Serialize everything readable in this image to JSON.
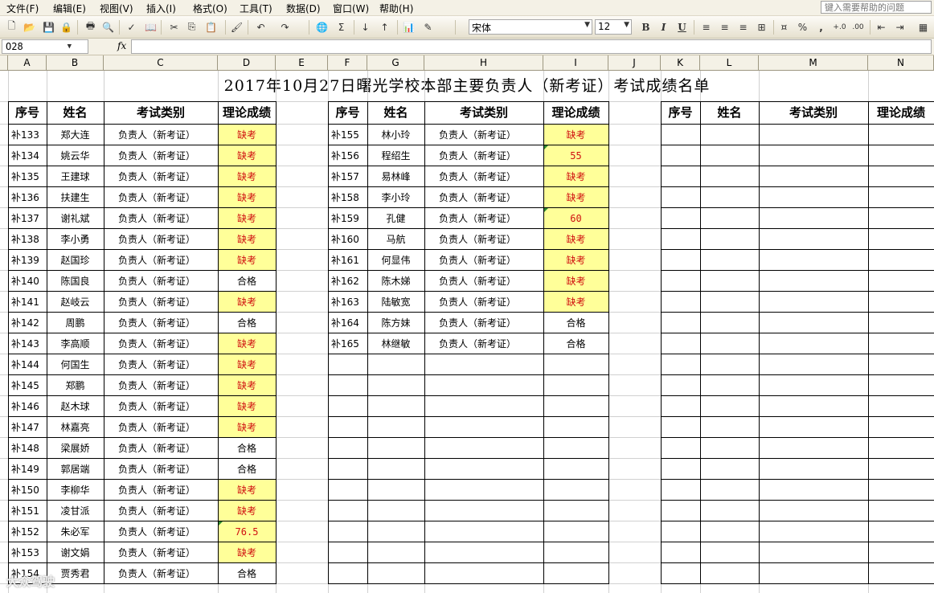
{
  "menu": [
    "文件(F)",
    "编辑(E)",
    "视图(V)",
    "插入(I)",
    "格式(O)",
    "工具(T)",
    "数据(D)",
    "窗口(W)",
    "帮助(H)"
  ],
  "help_search_placeholder": "键入需要帮助的问题",
  "toolbar": {
    "icons": [
      "new-icon",
      "open-icon",
      "save-icon",
      "permission-icon",
      "print-icon",
      "print-preview-icon",
      "spelling-icon",
      "research-icon",
      "cut-icon",
      "copy-icon",
      "paste-icon",
      "format-painter-icon",
      "undo-icon",
      "redo-icon",
      "hyperlink-icon",
      "autosum-icon",
      "sort-ascending-icon",
      "sort-descending-icon",
      "chart-icon",
      "drawing-icon"
    ],
    "font_name": "宋体",
    "font_size": "12",
    "bold": "B",
    "italic": "I",
    "underline": "U",
    "percent": "%",
    "comma": ","
  },
  "formula_bar": {
    "name_box": "O28",
    "fx": "fx",
    "formula": ""
  },
  "columns": [
    "A",
    "B",
    "C",
    "D",
    "E",
    "F",
    "G",
    "H",
    "I",
    "J",
    "K",
    "L",
    "M",
    "N"
  ],
  "sheet": {
    "title": "2017年10月27日曙光学校本部主要负责人（新考证）考试成绩名单",
    "headers": [
      "序号",
      "姓名",
      "考试类别",
      "理论成绩"
    ],
    "left_rows": [
      {
        "no": "补133",
        "name": "郑大连",
        "type": "负责人（新考证）",
        "score": "缺考"
      },
      {
        "no": "补134",
        "name": "姚云华",
        "type": "负责人（新考证）",
        "score": "缺考"
      },
      {
        "no": "补135",
        "name": "王建球",
        "type": "负责人（新考证）",
        "score": "缺考"
      },
      {
        "no": "补136",
        "name": "扶建生",
        "type": "负责人（新考证）",
        "score": "缺考"
      },
      {
        "no": "补137",
        "name": "谢礼斌",
        "type": "负责人（新考证）",
        "score": "缺考"
      },
      {
        "no": "补138",
        "name": "李小勇",
        "type": "负责人（新考证）",
        "score": "缺考"
      },
      {
        "no": "补139",
        "name": "赵国珍",
        "type": "负责人（新考证）",
        "score": "缺考"
      },
      {
        "no": "补140",
        "name": "陈国良",
        "type": "负责人（新考证）",
        "score": "合格"
      },
      {
        "no": "补141",
        "name": "赵岐云",
        "type": "负责人（新考证）",
        "score": "缺考"
      },
      {
        "no": "补142",
        "name": "周鹏",
        "type": "负责人（新考证）",
        "score": "合格"
      },
      {
        "no": "补143",
        "name": "李高顺",
        "type": "负责人（新考证）",
        "score": "缺考"
      },
      {
        "no": "补144",
        "name": "何国生",
        "type": "负责人（新考证）",
        "score": "缺考"
      },
      {
        "no": "补145",
        "name": "郑鹏",
        "type": "负责人（新考证）",
        "score": "缺考"
      },
      {
        "no": "补146",
        "name": "赵木球",
        "type": "负责人（新考证）",
        "score": "缺考"
      },
      {
        "no": "补147",
        "name": "林嘉亮",
        "type": "负责人（新考证）",
        "score": "缺考"
      },
      {
        "no": "补148",
        "name": "梁展娇",
        "type": "负责人（新考证）",
        "score": "合格"
      },
      {
        "no": "补149",
        "name": "郭居端",
        "type": "负责人（新考证）",
        "score": "合格"
      },
      {
        "no": "补150",
        "name": "李柳华",
        "type": "负责人（新考证）",
        "score": "缺考"
      },
      {
        "no": "补151",
        "name": "凌甘派",
        "type": "负责人（新考证）",
        "score": "缺考"
      },
      {
        "no": "补152",
        "name": "朱必军",
        "type": "负责人（新考证）",
        "score": "76.5"
      },
      {
        "no": "补153",
        "name": "谢文娟",
        "type": "负责人（新考证）",
        "score": "缺考"
      },
      {
        "no": "补154",
        "name": "贾秀君",
        "type": "负责人（新考证）",
        "score": "合格"
      }
    ],
    "middle_rows": [
      {
        "no": "补155",
        "name": "林小玲",
        "type": "负责人（新考证）",
        "score": "缺考"
      },
      {
        "no": "补156",
        "name": "程绍生",
        "type": "负责人（新考证）",
        "score": "55"
      },
      {
        "no": "补157",
        "name": "易林峰",
        "type": "负责人（新考证）",
        "score": "缺考"
      },
      {
        "no": "补158",
        "name": "李小玲",
        "type": "负责人（新考证）",
        "score": "缺考"
      },
      {
        "no": "补159",
        "name": "孔健",
        "type": "负责人（新考证）",
        "score": "60"
      },
      {
        "no": "补160",
        "name": "马航",
        "type": "负责人（新考证）",
        "score": "缺考"
      },
      {
        "no": "补161",
        "name": "何显伟",
        "type": "负责人（新考证）",
        "score": "缺考"
      },
      {
        "no": "补162",
        "name": "陈木娣",
        "type": "负责人（新考证）",
        "score": "缺考"
      },
      {
        "no": "补163",
        "name": "陆敏宽",
        "type": "负责人（新考证）",
        "score": "缺考"
      },
      {
        "no": "补164",
        "name": "陈方妹",
        "type": "负责人（新考证）",
        "score": "合格"
      },
      {
        "no": "补165",
        "name": "林继敏",
        "type": "负责人（新考证）",
        "score": "合格"
      }
    ]
  },
  "watermark": "大众驾驶",
  "colors": {
    "absent_fill": "#ffff99",
    "absent_text": "#d01010",
    "grid": "#d0d0d0",
    "chrome": "#f4f1e6"
  }
}
